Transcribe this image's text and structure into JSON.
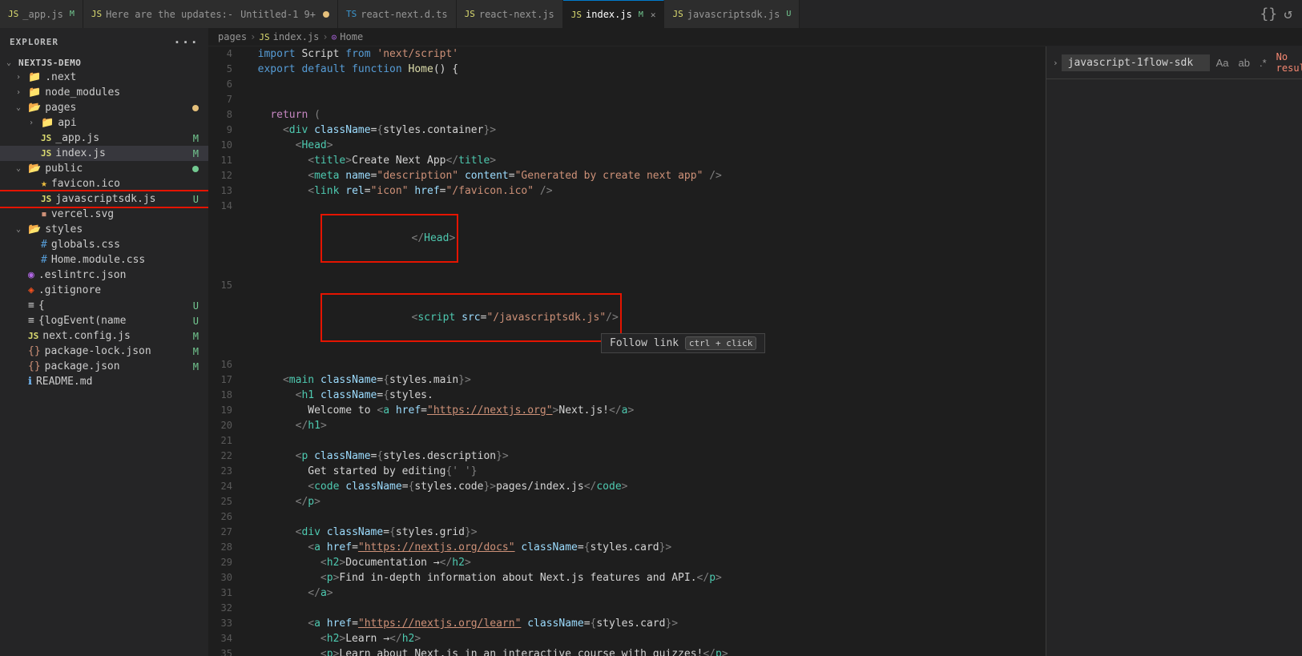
{
  "sidebar": {
    "header": "Explorer",
    "more_icon": "···",
    "project": {
      "name": "NEXTJS-DEMO",
      "items": [
        {
          "id": "next",
          "label": ".next",
          "indent": 1,
          "type": "folder",
          "chevron": "›"
        },
        {
          "id": "node_modules",
          "label": "node_modules",
          "indent": 1,
          "type": "folder",
          "chevron": "›"
        },
        {
          "id": "pages",
          "label": "pages",
          "indent": 1,
          "type": "folder-open",
          "chevron": "⌄",
          "dot": "yellow"
        },
        {
          "id": "api",
          "label": "api",
          "indent": 2,
          "type": "folder",
          "chevron": "›"
        },
        {
          "id": "_app_js",
          "label": "_app.js",
          "indent": 2,
          "type": "js",
          "badge": "M"
        },
        {
          "id": "index_js",
          "label": "index.js",
          "indent": 2,
          "type": "js",
          "badge": "M",
          "selected": true
        },
        {
          "id": "public",
          "label": "public",
          "indent": 1,
          "type": "folder-open",
          "chevron": "⌄",
          "dot": "green"
        },
        {
          "id": "favicon",
          "label": "favicon.ico",
          "indent": 2,
          "type": "star"
        },
        {
          "id": "javascriptsdk",
          "label": "javascriptsdk.js",
          "indent": 2,
          "type": "js",
          "badge": "U",
          "highlighted": true
        },
        {
          "id": "vercel_svg",
          "label": "vercel.svg",
          "indent": 2,
          "type": "svg"
        },
        {
          "id": "styles",
          "label": "styles",
          "indent": 1,
          "type": "folder-open",
          "chevron": "⌄"
        },
        {
          "id": "globals_css",
          "label": "globals.css",
          "indent": 2,
          "type": "css"
        },
        {
          "id": "home_css",
          "label": "Home.module.css",
          "indent": 2,
          "type": "css"
        },
        {
          "id": "eslintrc",
          "label": ".eslintrc.json",
          "indent": 1,
          "type": "eslint"
        },
        {
          "id": "gitignore",
          "label": ".gitignore",
          "indent": 1,
          "type": "git"
        },
        {
          "id": "bracket1",
          "label": "{",
          "indent": 1,
          "type": "bracket",
          "badge": "U"
        },
        {
          "id": "logEvent",
          "label": "{logEvent(name",
          "indent": 1,
          "type": "bracket",
          "badge": "U"
        },
        {
          "id": "next_config",
          "label": "next.config.js",
          "indent": 1,
          "type": "js",
          "badge": "M"
        },
        {
          "id": "package_lock",
          "label": "package-lock.json",
          "indent": 1,
          "type": "json",
          "badge": "M"
        },
        {
          "id": "package_json",
          "label": "package.json",
          "indent": 1,
          "type": "json",
          "badge": "M"
        },
        {
          "id": "readme",
          "label": "README.md",
          "indent": 1,
          "type": "info"
        }
      ]
    }
  },
  "tabs": [
    {
      "id": "app_js",
      "label": "_app.js",
      "type": "js",
      "badge": "M",
      "active": false
    },
    {
      "id": "here_are_updates",
      "label": "Here are the updates:-",
      "extra": "Untitled-1 9+",
      "type": "js",
      "dot": true,
      "active": false
    },
    {
      "id": "react_next_d",
      "label": "react-next.d.ts",
      "type": "ts",
      "active": false
    },
    {
      "id": "react_next",
      "label": "react-next.js",
      "type": "js",
      "active": false
    },
    {
      "id": "index_js",
      "label": "index.js",
      "type": "js",
      "badge": "M",
      "active": true,
      "close": true
    },
    {
      "id": "javascriptsdk",
      "label": "javascriptsdk.js",
      "type": "js",
      "badge": "U",
      "active": false
    }
  ],
  "breadcrumb": {
    "parts": [
      "pages",
      ">",
      "JS index.js",
      ">",
      "⊙ Home"
    ]
  },
  "search": {
    "placeholder": "javascript-1flow-sdk",
    "value": "javascript-1flow-sdk",
    "no_results": "No results",
    "match_case_label": "Aa",
    "match_word_label": "ab",
    "regex_label": ".*"
  },
  "tooltip": {
    "text": "Follow link",
    "shortcut": "ctrl + click"
  },
  "code": {
    "lines": [
      {
        "num": 4,
        "indicator": true,
        "content": "  import Script from 'next/script'"
      },
      {
        "num": 5,
        "indicator": false,
        "content": "  export default function Home() {"
      },
      {
        "num": 6,
        "indicator": false,
        "content": ""
      },
      {
        "num": 7,
        "indicator": true,
        "content": ""
      },
      {
        "num": 8,
        "indicator": false,
        "content": "    return ("
      },
      {
        "num": 9,
        "indicator": false,
        "content": "      <div className={styles.container}>"
      },
      {
        "num": 10,
        "indicator": false,
        "content": "        <Head>"
      },
      {
        "num": 11,
        "indicator": false,
        "content": "          <title>Create Next App</title>"
      },
      {
        "num": 12,
        "indicator": false,
        "content": "          <meta name=\"description\" content=\"Generated by create next app\" />"
      },
      {
        "num": 13,
        "indicator": false,
        "content": "          <link rel=\"icon\" href=\"/favicon.ico\" />"
      },
      {
        "num": 14,
        "indicator": false,
        "content": "        </Head>",
        "red_box_start": true
      },
      {
        "num": 15,
        "indicator": false,
        "content": "        <script src=\"/javascriptsdk.js\"/>",
        "red_box": true
      },
      {
        "num": 16,
        "indicator": false,
        "content": ""
      },
      {
        "num": 17,
        "indicator": false,
        "content": "      <main className={styles.main}>"
      },
      {
        "num": 18,
        "indicator": false,
        "content": "        <h1 className={styles."
      },
      {
        "num": 19,
        "indicator": false,
        "content": "          Welcome to <a href=\"https://nextjs.org\">Next.js!</a>"
      },
      {
        "num": 20,
        "indicator": false,
        "content": "        </h1>"
      },
      {
        "num": 21,
        "indicator": false,
        "content": ""
      },
      {
        "num": 22,
        "indicator": false,
        "content": "        <p className={styles.description}>"
      },
      {
        "num": 23,
        "indicator": false,
        "content": "          Get started by editing{' '}"
      },
      {
        "num": 24,
        "indicator": false,
        "content": "          <code className={styles.code}>pages/index.js</code>"
      },
      {
        "num": 25,
        "indicator": false,
        "content": "        </p>"
      },
      {
        "num": 26,
        "indicator": false,
        "content": ""
      },
      {
        "num": 27,
        "indicator": false,
        "content": "        <div className={styles.grid}>"
      },
      {
        "num": 28,
        "indicator": false,
        "content": "          <a href=\"https://nextjs.org/docs\" className={styles.card}>"
      },
      {
        "num": 29,
        "indicator": false,
        "content": "            <h2>Documentation &rarr;</h2>"
      },
      {
        "num": 30,
        "indicator": false,
        "content": "            <p>Find in-depth information about Next.js features and API.</p>"
      },
      {
        "num": 31,
        "indicator": false,
        "content": "          </a>"
      },
      {
        "num": 32,
        "indicator": false,
        "content": ""
      },
      {
        "num": 33,
        "indicator": false,
        "content": "          <a href=\"https://nextjs.org/learn\" className={styles.card}>"
      },
      {
        "num": 34,
        "indicator": false,
        "content": "            <h2>Learn &rarr;</h2>"
      },
      {
        "num": 35,
        "indicator": false,
        "content": "            <p>Learn about Next.js in an interactive course with quizzes!</p>"
      }
    ]
  }
}
